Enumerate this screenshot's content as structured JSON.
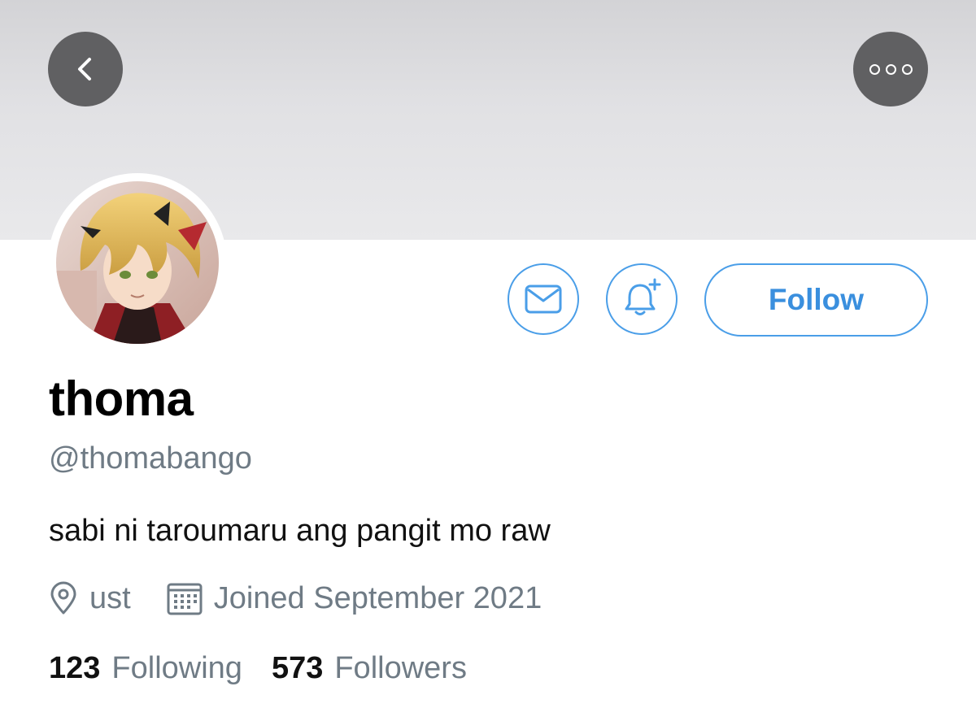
{
  "header": {
    "back_icon": "chevron-left-icon",
    "more_icon": "more-horizontal-icon"
  },
  "profile": {
    "avatar": "anime-avatar",
    "display_name": "thoma",
    "handle": "@thomabango",
    "bio": "sabi ni taroumaru ang pangit mo raw",
    "location": "ust",
    "joined": "Joined September 2021"
  },
  "actions": {
    "message_icon": "envelope-icon",
    "notify_icon": "bell-plus-icon",
    "follow_label": "Follow"
  },
  "stats": {
    "following_count": "123",
    "following_label": "Following",
    "followers_count": "573",
    "followers_label": "Followers"
  },
  "colors": {
    "accent": "#3a8fde",
    "secondary_text": "#6f7b85",
    "banner": "#e1e1e4"
  }
}
